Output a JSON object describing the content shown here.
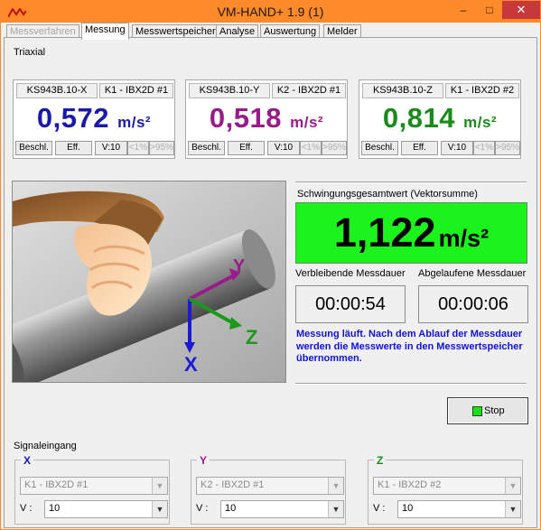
{
  "window": {
    "title": "VM-HAND+ 1.9 (1)",
    "minimize_glyph": "–",
    "maximize_glyph": "□",
    "close_glyph": "✕",
    "accent": "#ff8a2a"
  },
  "tabs": [
    {
      "label": "Messverfahren",
      "state": "disabled"
    },
    {
      "label": "Messung",
      "state": "active"
    },
    {
      "label": "Messwertspeicher",
      "state": "normal"
    },
    {
      "label": "Analyse",
      "state": "normal"
    },
    {
      "label": "Auswertung",
      "state": "normal"
    },
    {
      "label": "Melder",
      "state": "normal"
    }
  ],
  "mode_label": "Triaxial",
  "sensors": [
    {
      "sensor": "KS943B.10-X",
      "channel": "K1 - IBX2D #1",
      "value": "0,572",
      "unit": "m/s²",
      "color": "#1a1aa8",
      "buttons": [
        "Beschl.",
        "Eff.",
        "V:10",
        "<1%",
        ">95%"
      ]
    },
    {
      "sensor": "KS943B.10-Y",
      "channel": "K2 - IBX2D #1",
      "value": "0,518",
      "unit": "m/s²",
      "color": "#9a1a8a",
      "buttons": [
        "Beschl.",
        "Eff.",
        "V:10",
        "<1%",
        ">95%"
      ]
    },
    {
      "sensor": "KS943B.10-Z",
      "channel": "K1 - IBX2D #2",
      "value": "0,814",
      "unit": "m/s²",
      "color": "#1a8a1a",
      "buttons": [
        "Beschl.",
        "Eff.",
        "V:10",
        "<1%",
        ">95%"
      ]
    }
  ],
  "illustration": {
    "axis_x": "X",
    "axis_y": "Y",
    "axis_z": "Z"
  },
  "total": {
    "label": "Schwingungsgesamtwert (Vektorsumme)",
    "value": "1,122",
    "unit": "m/s²",
    "color": "#1cf21c"
  },
  "remaining": {
    "label": "Verbleibende Messdauer",
    "value": "00:00:54"
  },
  "elapsed": {
    "label": "Abgelaufene Messdauer",
    "value": "00:00:06"
  },
  "status_message": "Messung läuft. Nach dem Ablauf der Messdauer werden die Messwerte in den Messwertspeicher übernommen.",
  "stop_button": {
    "label": "Stop"
  },
  "signal_input": {
    "label": "Signaleingang",
    "groups": [
      {
        "axis": "X",
        "axis_color": "#1a1aa8",
        "channel": "K1 - IBX2D #1",
        "v_label": "V :",
        "v_value": "10"
      },
      {
        "axis": "Y",
        "axis_color": "#9a1a8a",
        "channel": "K2 - IBX2D #1",
        "v_label": "V :",
        "v_value": "10"
      },
      {
        "axis": "Z",
        "axis_color": "#1a8a1a",
        "channel": "K1 - IBX2D #2",
        "v_label": "V :",
        "v_value": "10"
      }
    ]
  }
}
